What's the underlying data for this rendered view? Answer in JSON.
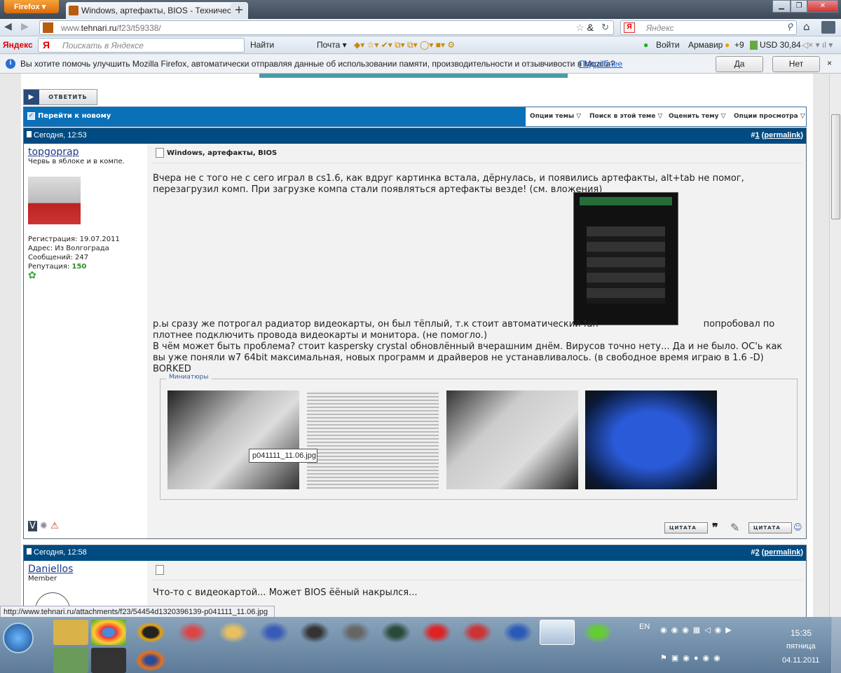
{
  "browser": {
    "menu_button": "Firefox",
    "tab_title": "Windows, артефакты, BIOS - Техническ...",
    "new_tab": "+",
    "url_prefix": "www.",
    "url_domain": "tehnari.ru",
    "url_path": "/f23/t59338/",
    "search_placeholder": "Яндекс"
  },
  "yandex_bar": {
    "logo": "Яндекс",
    "search_placeholder": "Поискать в Яндексе",
    "find": "Найти",
    "mail": "Почта",
    "login": "Войти",
    "city": "Армавир",
    "weather": "+9",
    "currency": "USD 30,84"
  },
  "notification": {
    "text": "Вы хотите помочь улучшить Mozilla Firefox, автоматически отправляя данные об использовании памяти, производительности и отзывчивости в Mozilla?",
    "link": "Подробнее",
    "yes": "Да",
    "no": "Нет",
    "close": "×"
  },
  "thread": {
    "reply": "ОТВЕТИТЬ",
    "goto_new": "Перейти к новому",
    "options": [
      "Опции темы",
      "Поиск в этой теме",
      "Оценить тему",
      "Опции просмотра"
    ]
  },
  "posts": [
    {
      "date": "Сегодня, 12:53",
      "num": "1",
      "permalink": "permalink",
      "user": "topgoprap",
      "user_title": "Червь в яблоке и в компе.",
      "reg": "Регистрация: 19.07.2011",
      "address": "Адрес: Из Волгограда",
      "messages": "Сообщений: 247",
      "rep_label": "Репутация:",
      "rep_value": "150",
      "title": "Windows, артефакты, BIOS",
      "text1": "Вчера не с того не с сего играл в cs1.6, как вдруг картинка встала, дёрнулась, и появились артефакты, alt+tab не помог, перезагрузил комп. При загрузке компа стали появляться артефакты везде! (см. вложения)",
      "text2a": "р.ы сразу же потрогал радиатор видеокарты, он был тёплый, т.к стоит автоматический fan",
      "text2b": "попробовал по плотнее подключить провода видеокарты и монитора. (не помогло.)",
      "text3": "В чём может быть проблема? стоит kaspersky crystal обновлённый вчерашним днём. Вирусов точно нету... Да и не было. ОС'ь как вы уже поняли w7 64bit максимальная, новых программ и драйверов не устанавливалось. (в свободное время играю в 1.6 -D)",
      "text4": "BORKED",
      "thumbs_label": "Миниатюры",
      "tooltip": "p041111_11.06.jpg",
      "quote": "ЦИТАТА",
      "multiquote": "ЦИТАТА"
    },
    {
      "date": "Сегодня, 12:58",
      "num": "2",
      "permalink": "permalink",
      "user": "Daniellos",
      "user_title": "Member",
      "text1": "Что-то с видеокартой... Может BIOS ёёный накрылся..."
    }
  ],
  "status_url": "http://www.tehnari.ru/attachments/f23/54454d1320396139-p041111_11.06.jpg",
  "tray": {
    "lang": "EN",
    "time": "15:35",
    "day": "пятница",
    "date": "04.11.2011"
  }
}
